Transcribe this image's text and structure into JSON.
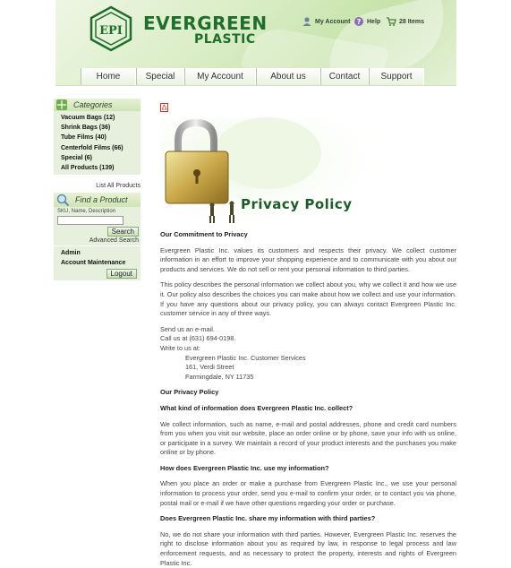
{
  "header": {
    "logo_mark": "EPI",
    "logo_line1": "EVERGREEN",
    "logo_line2": "PLASTIC",
    "utility": [
      {
        "icon": "user-icon",
        "label": "My Account"
      },
      {
        "icon": "help-icon",
        "label": "Help"
      },
      {
        "icon": "cart-icon",
        "label": "28 Items"
      }
    ]
  },
  "nav": [
    "Home",
    "Special",
    "My Account",
    "About us",
    "Contact",
    "Support"
  ],
  "sidebar": {
    "categories_title": "Categories",
    "categories": [
      "Vacuum Bags (12)",
      "Shrink Bags (36)",
      "Tube Films (40)",
      "Centerfold Films (66)",
      "Special (6)",
      "All Products (139)"
    ],
    "list_all": "List All Products",
    "find_title": "Find a Product",
    "find_label": "SKU, Name, Description",
    "search_button": "Search",
    "advanced_search": "Advanced Search",
    "admin_items": [
      "Admin",
      "Account Maintenance"
    ],
    "logout_button": "Logout"
  },
  "banner": {
    "title": "Privacy Policy"
  },
  "content": {
    "h_commitment": "Our Commitment to Privacy",
    "p1": "Evergreen Plastic Inc. values its customers and respects their privacy. We collect customer information in an effort to improve your shopping experience and to communicate with you about our products and services. We do not sell or rent your personal information to third parties.",
    "p2": "This policy describes the personal information we collect about you, why we collect it and how we use it. Our policy also describes the choices you can make about how we collect and use your information. If you have any questions about our privacy policy, you can always contact Evergreen Plastic Inc. customer service in any of three ways.",
    "contact_lines": [
      "Send us an e-mail.",
      "Call us at (631) 694-0198.",
      "Write to us at:"
    ],
    "address_lines": [
      "Evergreen Plastic Inc. Customer Services",
      "161, Verdi Street",
      "Farmingdale, NY 11735"
    ],
    "h_policy": "Our Privacy Policy",
    "q1": "What kind of information does Evergreen Plastic Inc. collect?",
    "a1": "We collect information, such as name, e-mail and postal addresses, phone and credit card numbers from you when you visit our website, place an order online or by phone, save your info with us online, or participate in a survey. We maintain a record of your product interests and the purchases you make online or by phone.",
    "q2": "How does Evergreen Plastic Inc. use my information?",
    "a2": "When you place an order or make a purchase from Evergreen Plastic Inc., we use your personal information to process your order, send you e-mail to confirm your order, or to contact you via phone, postal mail or e-mail if we have other questions regarding your order or purchase.",
    "q3": "Does Evergreen Plastic Inc. share my information with third parties?",
    "a3": "No, we do not share your information with third parties. However, Evergreen Plastic Inc. reserves the right to disclose information about you as required by law, in response to legal process and law enforcement requests, and as necessary to protect the property, interests and rights of Evergreen Plastic Inc."
  },
  "colors": {
    "brand_green": "#1f6e2e",
    "sidebar_bg": "#e6f0dc"
  }
}
